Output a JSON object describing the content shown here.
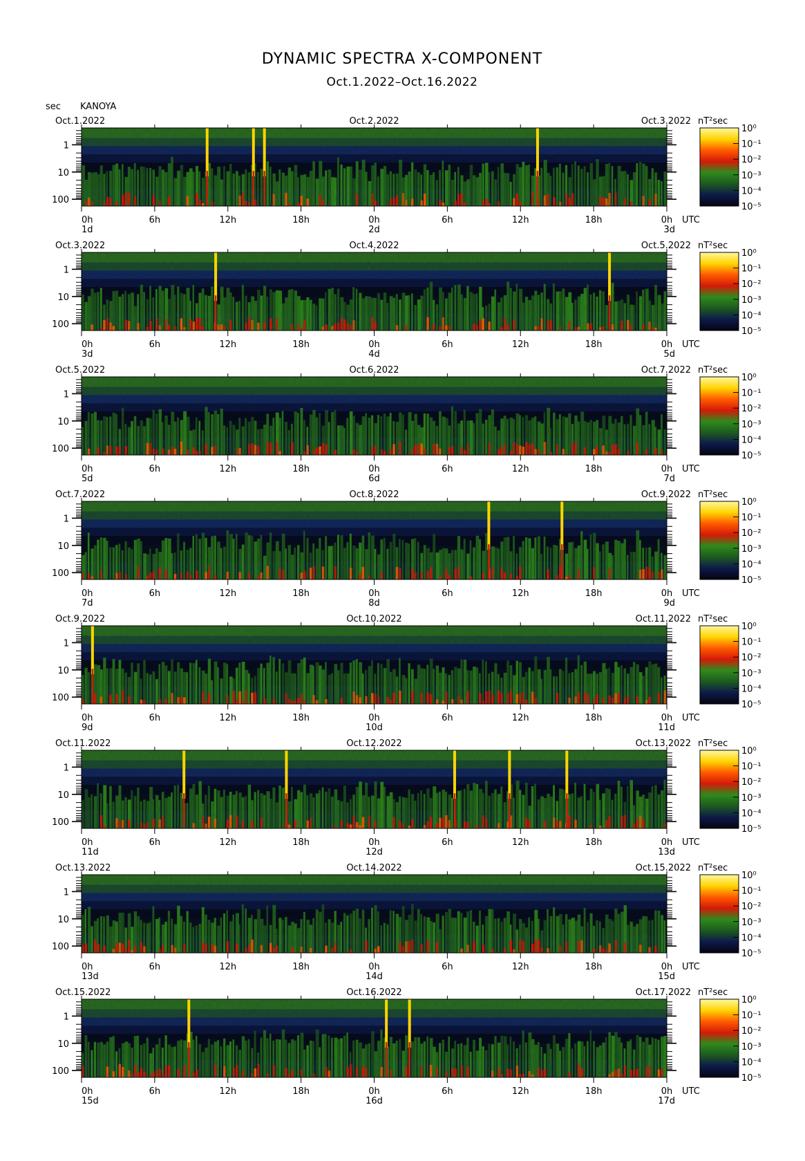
{
  "header": {
    "title": "DYNAMIC SPECTRA X-COMPONENT",
    "subtitle": "Oct.1.2022–Oct.16.2022",
    "y_unit": "sec",
    "station": "KANOYA"
  },
  "colors": {
    "background": "#ffffff",
    "colormap": [
      "#050510",
      "#0d1a4a",
      "#1d5a1f",
      "#2f8a1c",
      "#d41a08",
      "#ff5a00",
      "#ffd400",
      "#fff7a0"
    ]
  },
  "chart_data": {
    "type": "heatmap",
    "title": "DYNAMIC SPECTRA X-COMPONENT",
    "subtitle": "Oct.1.2022–Oct.16.2022",
    "ylabel": "sec",
    "y_ticks": [
      "1",
      "10",
      "100"
    ],
    "y_scale": "log",
    "x_ticks": [
      "0h",
      "6h",
      "12h",
      "18h",
      "0h",
      "6h",
      "12h",
      "18h",
      "0h"
    ],
    "x_unit": "UTC",
    "colorbar": {
      "label": "nT²sec",
      "ticks": [
        "10⁰",
        "10⁻¹",
        "10⁻²",
        "10⁻³",
        "10⁻⁴",
        "10⁻⁵"
      ],
      "range_log10": [
        -5,
        0
      ]
    },
    "grid": false,
    "panels": [
      {
        "start_date": "Oct.1.2022",
        "mid_date": "Oct.2.2022",
        "end_date": "Oct.3.2022",
        "day_labels": [
          "1d",
          "2d",
          "3d"
        ],
        "spike_times_h": [
          10.3,
          14.1,
          15.0,
          37.4
        ]
      },
      {
        "start_date": "Oct.3.2022",
        "mid_date": "Oct.4.2022",
        "end_date": "Oct.5.2022",
        "day_labels": [
          "3d",
          "4d",
          "5d"
        ],
        "spike_times_h": [
          11.0,
          43.3
        ]
      },
      {
        "start_date": "Oct.5.2022",
        "mid_date": "Oct.6.2022",
        "end_date": "Oct.7.2022",
        "day_labels": [
          "5d",
          "6d",
          "7d"
        ],
        "spike_times_h": []
      },
      {
        "start_date": "Oct.7.2022",
        "mid_date": "Oct.8.2022",
        "end_date": "Oct.9.2022",
        "day_labels": [
          "7d",
          "8d",
          "9d"
        ],
        "spike_times_h": [
          33.4,
          39.4
        ]
      },
      {
        "start_date": "Oct.9.2022",
        "mid_date": "Oct.10.2022",
        "end_date": "Oct.11.2022",
        "day_labels": [
          "9d",
          "10d",
          "11d"
        ],
        "spike_times_h": [
          0.9
        ]
      },
      {
        "start_date": "Oct.11.2022",
        "mid_date": "Oct.12.2022",
        "end_date": "Oct.13.2022",
        "day_labels": [
          "11d",
          "12d",
          "13d"
        ],
        "spike_times_h": [
          8.4,
          16.8,
          30.6,
          35.1,
          39.8
        ]
      },
      {
        "start_date": "Oct.13.2022",
        "mid_date": "Oct.14.2022",
        "end_date": "Oct.15.2022",
        "day_labels": [
          "13d",
          "14d",
          "15d"
        ],
        "spike_times_h": []
      },
      {
        "start_date": "Oct.15.2022",
        "mid_date": "Oct.16.2022",
        "end_date": "Oct.17.2022",
        "day_labels": [
          "15d",
          "16d",
          "17d"
        ],
        "spike_times_h": [
          8.8,
          25.0,
          26.9
        ]
      }
    ]
  }
}
